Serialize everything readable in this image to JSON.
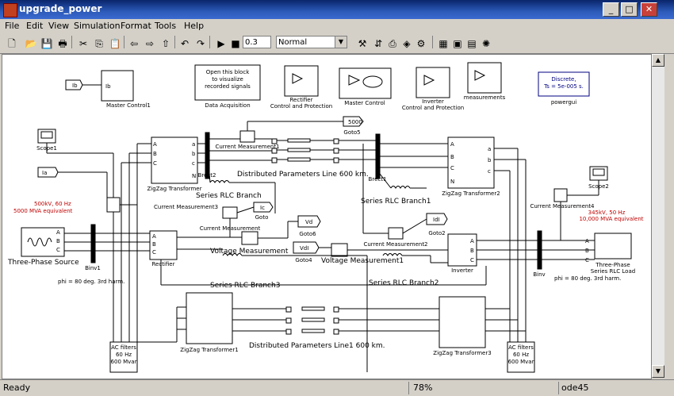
{
  "window": {
    "title": "upgrade_power"
  },
  "menu": [
    "File",
    "Edit",
    "View",
    "Simulation",
    "Format",
    "Tools",
    "Help"
  ],
  "toolbar": {
    "stop_time": "0.3",
    "sim_mode": "Normal"
  },
  "blocks": {
    "master_control1": "Master Control1",
    "data_acq_text": [
      "Open this block",
      "to visualize",
      "recorded signals"
    ],
    "data_acquisition": "Data Acquisition",
    "rectifier_cp": [
      "Rectifier",
      "Control and Protection"
    ],
    "master_control": "Master Control",
    "inverter_cp": [
      "Inverter",
      "Control and Protection"
    ],
    "measurements": "measurements",
    "powergui_text": [
      "Discrete,",
      "Ts = 5e-005 s."
    ],
    "powergui": "powergui",
    "scope1": "Scope1",
    "scope2": "Scope2",
    "goto5": "Goto5",
    "goto5_tag": "5000",
    "goto": "Goto",
    "goto_tag": "Ic",
    "goto6": "Goto6",
    "goto6_tag": "Vd",
    "goto4": "Goto4",
    "goto4_tag": "VdI",
    "goto2": "Goto2",
    "goto2_tag": "IdI",
    "from_ib": "Ib",
    "from_ia": "Ia",
    "zz_t": "ZigZag Transformer",
    "zz_t2": "ZigZag Transformer2",
    "zz_t1": "ZigZag Transformer1",
    "zz_t3": "ZigZag Transformer3",
    "brect2": "Brect2",
    "brect1": "Brect1",
    "bin1": "Binv1",
    "binv": "Binv",
    "cm1": "Current Measurement1",
    "cm3": "Current Measurement3",
    "cm4": "Current Measurement4",
    "cm": "Current Measurement",
    "cm2": "Current Measurement2",
    "dpl": "Distributed Parameters Line 600 km.",
    "dpl1": "Distributed Parameters Line1  600 km.",
    "srlc": "Series RLC Branch",
    "srlc1": "Series RLC Branch1",
    "srlc2": "Series RLC Branch2",
    "srlc3": "Series RLC Branch3",
    "vm": "Voltage Measurement",
    "vm1": "Voltage Measurement1",
    "rectifier": "Rectifier",
    "inverter": "Inverter",
    "source": "Three-Phase Source",
    "source_spec": [
      "500kV, 60 Hz",
      "5000 MVA equivalent"
    ],
    "load_spec": [
      "345kV, 50 Hz",
      "10,000 MVA equivalent"
    ],
    "load": [
      "Three-Phase",
      "Series RLC Load"
    ],
    "phi_left": "phi = 80 deg. 3rd harm.",
    "phi_right": "phi = 80 deg. 3rd harm.",
    "ac_filters_text": [
      "AC filters",
      "60 Hz",
      "600 Mvar"
    ]
  },
  "status": {
    "left": "Ready",
    "zoom": "78%",
    "solver": "ode45"
  },
  "colors": {
    "title_bar": "#0a246a",
    "annotation_red": "#c00000",
    "powergui_blue": "#000080"
  }
}
